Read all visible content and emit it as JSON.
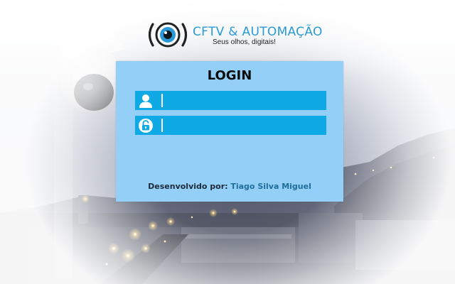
{
  "logo": {
    "title": "CFTV & AUTOMAÇÃO",
    "tagline": "Seus olhos, digitais!",
    "icon": "camera-eye-icon"
  },
  "login": {
    "title": "LOGIN",
    "username": {
      "icon": "user-icon",
      "value": "",
      "placeholder": ""
    },
    "password": {
      "icon": "padlock-icon",
      "value": "",
      "placeholder": ""
    }
  },
  "credits": {
    "label": "Desenvolvido por:",
    "author": "Tiago Silva Miguel"
  },
  "colors": {
    "panel": "#94cff7",
    "field": "#0fa9e5",
    "brand": "#2a9ad6",
    "author": "#1e6e9c"
  }
}
